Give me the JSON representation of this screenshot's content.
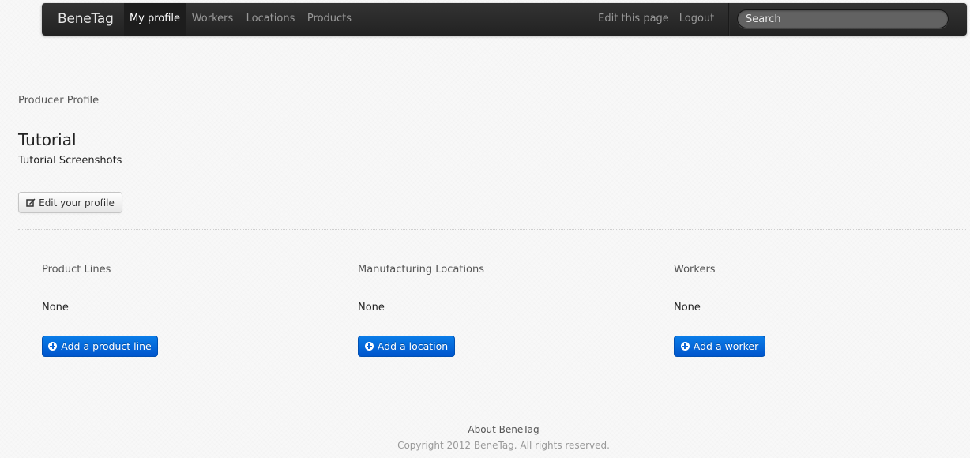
{
  "navbar": {
    "brand": "BeneTag",
    "links": [
      {
        "label": "My profile",
        "active": true
      },
      {
        "label": "Workers",
        "active": false
      },
      {
        "label": "Locations",
        "active": false
      },
      {
        "label": "Products",
        "active": false
      }
    ],
    "right_links": [
      {
        "label": "Edit this page"
      },
      {
        "label": "Logout"
      }
    ],
    "search_placeholder": "Search"
  },
  "profile": {
    "section_label": "Producer Profile",
    "title": "Tutorial",
    "subtitle": "Tutorial Screenshots",
    "edit_button": "Edit your profile"
  },
  "columns": [
    {
      "heading": "Product Lines",
      "value": "None",
      "button": "Add a product line"
    },
    {
      "heading": "Manufacturing Locations",
      "value": "None",
      "button": "Add a location"
    },
    {
      "heading": "Workers",
      "value": "None",
      "button": "Add a worker"
    }
  ],
  "footer": {
    "link": "About BeneTag",
    "copyright": "Copyright 2012 BeneTag. All rights reserved."
  },
  "colors": {
    "navbar_bg": "#222222",
    "primary_button": "#0066dd",
    "page_bg": "#f8f8f8"
  }
}
